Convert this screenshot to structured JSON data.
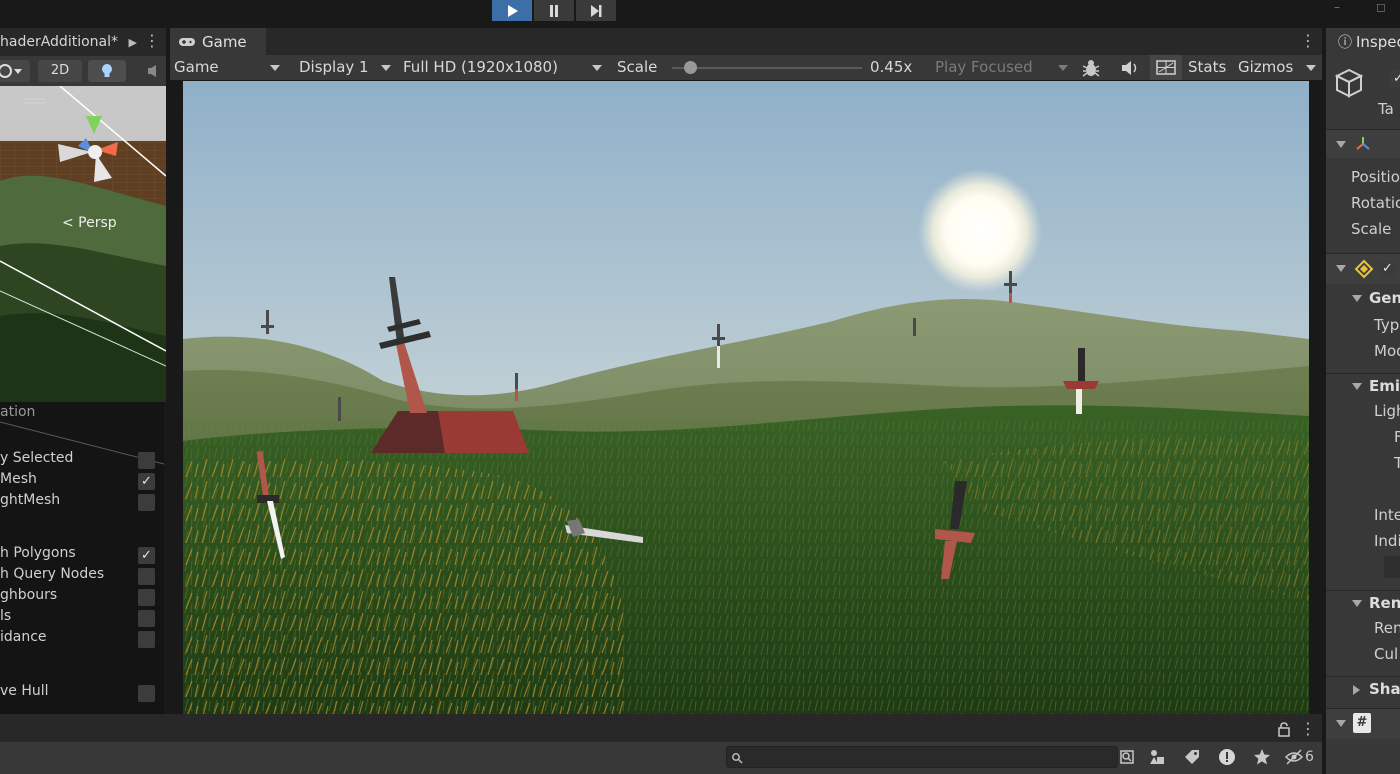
{
  "toolbar": {
    "play_icon": "play-icon",
    "pause_icon": "pause-icon",
    "step_icon": "step-icon"
  },
  "scene": {
    "tab_title": "haderAdditional*",
    "mode_2d": "2D",
    "persp_label": "< Persp"
  },
  "nav_overlay": {
    "title": "ation",
    "rows": [
      {
        "label": "y Selected",
        "checked": false
      },
      {
        "label": "Mesh",
        "checked": true
      },
      {
        "label": "ghtMesh",
        "checked": false
      },
      {
        "label": "h Polygons",
        "checked": true
      },
      {
        "label": "h Query Nodes",
        "checked": false
      },
      {
        "label": "ghbours",
        "checked": false
      },
      {
        "label": "ls",
        "checked": false
      },
      {
        "label": "idance",
        "checked": false
      },
      {
        "label": "ve Hull",
        "checked": false
      }
    ],
    "check_glyph": "✓"
  },
  "game": {
    "tab_label": "Game",
    "view_mode": "Game",
    "display": "Display 1",
    "resolution": "Full HD (1920x1080)",
    "scale_label": "Scale",
    "scale_value": "0.45x",
    "scale_fraction": 0.45,
    "play_mode": "Play Focused",
    "stats_label": "Stats",
    "gizmos_label": "Gizmos"
  },
  "inspector": {
    "tab_label": "Inspec",
    "tag_label": "Ta",
    "transform_labels": [
      "Positio",
      "Rotatio",
      "Scale"
    ],
    "sections": [
      "Gene",
      "Emis",
      "Rend",
      "Shad"
    ],
    "general_fields": [
      "Typ",
      "Mod"
    ],
    "emission_fields": [
      "Ligh",
      "F",
      "T",
      "Inte",
      "Indi"
    ],
    "renderer_fields": [
      "Ren",
      "Cul"
    ]
  },
  "bottom": {
    "search_placeholder": "",
    "hidden_count": "6"
  },
  "colors": {
    "accent": "#3c6fa8",
    "panel": "#383838",
    "tab_bg": "#282828",
    "background": "#191919"
  }
}
